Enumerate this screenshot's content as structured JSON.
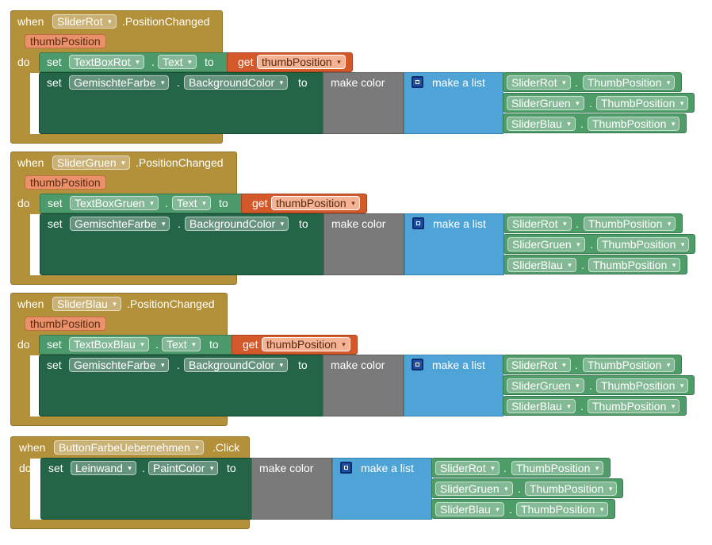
{
  "keywords": {
    "when": "when",
    "do": "do",
    "set": "set",
    "to": "to",
    "get": "get",
    "dot": ".",
    "make_color": "make color",
    "make_a_list": "make a list",
    "dropdown_arrow": "▾"
  },
  "blocks": [
    {
      "component": "SliderRot",
      "event": ".PositionChanged",
      "param": "thumbPosition",
      "text_target": "TextBoxRot",
      "text_prop": "Text",
      "get_var": "thumbPosition",
      "color_target": "GemischteFarbe",
      "color_prop": "BackgroundColor",
      "list_items": [
        {
          "component": "SliderRot",
          "prop": "ThumbPosition"
        },
        {
          "component": "SliderGruen",
          "prop": "ThumbPosition"
        },
        {
          "component": "SliderBlau",
          "prop": "ThumbPosition"
        }
      ]
    },
    {
      "component": "SliderGruen",
      "event": ".PositionChanged",
      "param": "thumbPosition",
      "text_target": "TextBoxGruen",
      "text_prop": "Text",
      "get_var": "thumbPosition",
      "color_target": "GemischteFarbe",
      "color_prop": "BackgroundColor",
      "list_items": [
        {
          "component": "SliderRot",
          "prop": "ThumbPosition"
        },
        {
          "component": "SliderGruen",
          "prop": "ThumbPosition"
        },
        {
          "component": "SliderBlau",
          "prop": "ThumbPosition"
        }
      ]
    },
    {
      "component": "SliderBlau",
      "event": ".PositionChanged",
      "param": "thumbPosition",
      "text_target": "TextBoxBlau",
      "text_prop": "Text",
      "get_var": "thumbPosition",
      "color_target": "GemischteFarbe",
      "color_prop": "BackgroundColor",
      "list_items": [
        {
          "component": "SliderRot",
          "prop": "ThumbPosition"
        },
        {
          "component": "SliderGruen",
          "prop": "ThumbPosition"
        },
        {
          "component": "SliderBlau",
          "prop": "ThumbPosition"
        }
      ]
    },
    {
      "component": "ButtonFarbeUebernehmen",
      "event": ".Click",
      "color_target": "Leinwand",
      "color_prop": "PaintColor",
      "list_items": [
        {
          "component": "SliderRot",
          "prop": "ThumbPosition"
        },
        {
          "component": "SliderGruen",
          "prop": "ThumbPosition"
        },
        {
          "component": "SliderBlau",
          "prop": "ThumbPosition"
        }
      ]
    }
  ],
  "colors": {
    "event_block": "#b3903a",
    "setter_block": "#256547",
    "component_getter": "#4e9c68",
    "variable_getter": "#d3582a",
    "make_color": "#7a7a7a",
    "make_list": "#4ea4d6"
  },
  "icons": {
    "dropdown": "dropdown-arrow-icon",
    "mutator": "mutator-gear-icon"
  }
}
